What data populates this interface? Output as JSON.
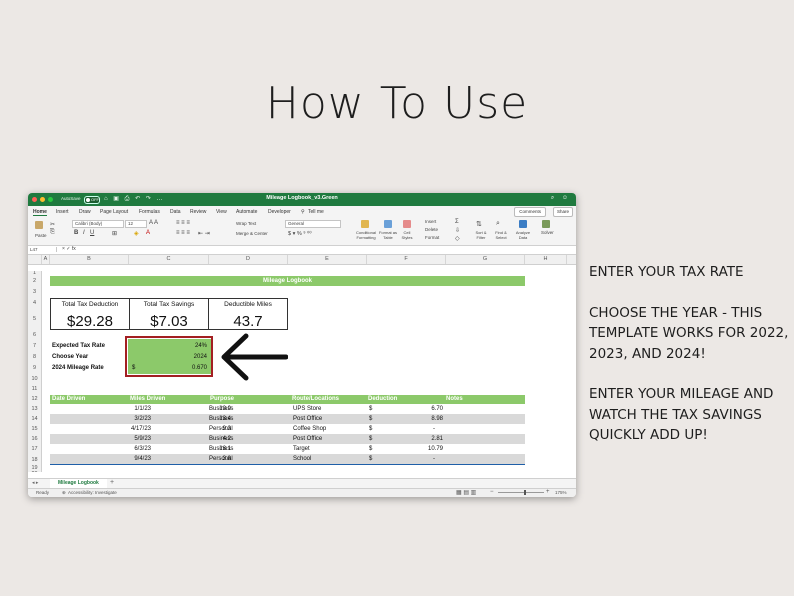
{
  "page_title": "How To Use",
  "instructions": [
    "ENTER YOUR TAX RATE",
    "CHOOSE THE YEAR - THIS TEMPLATE WORKS FOR 2022, 2023, AND 2024!",
    "ENTER YOUR MILEAGE AND WATCH THE TAX SAVINGS QUICKLY ADD UP!"
  ],
  "app": {
    "autosave_label": "AutoSave",
    "autosave_state": "OFF",
    "document_title": "Mileage Logbook_v3.Green",
    "menu": [
      "Home",
      "Insert",
      "Draw",
      "Page Layout",
      "Formulas",
      "Data",
      "Review",
      "View",
      "Automate",
      "Developer"
    ],
    "tell_me": "Tell me",
    "comments_label": "Comments",
    "share_label": "Share"
  },
  "ribbon": {
    "font_name": "Calibri (Body)",
    "font_size": "12",
    "paste_label": "Paste",
    "wrap_text": "Wrap Text",
    "merge_center": "Merge & Center",
    "number_format": "General",
    "conditional_formatting": "Conditional Formatting",
    "format_as_table": "Format as Table",
    "cell_styles": "Cell Styles",
    "insert": "Insert",
    "delete": "Delete",
    "format": "Format",
    "sort_filter": "Sort & Filter",
    "find_select": "Find & Select",
    "analyze_data": "Analyze Data",
    "solver": "Solver"
  },
  "formula_bar": {
    "name_box": "L47"
  },
  "columns": [
    "A",
    "B",
    "C",
    "D",
    "E",
    "F",
    "G",
    "H"
  ],
  "rows": [
    "1",
    "2",
    "3",
    "4",
    "5",
    "6",
    "7",
    "8",
    "9",
    "10",
    "11",
    "12",
    "13",
    "14",
    "15",
    "16",
    "17",
    "18",
    "19",
    "20"
  ],
  "sheet": {
    "banner": "Mileage Logbook",
    "summary": [
      {
        "label": "Total Tax Deduction",
        "value": "$29.28"
      },
      {
        "label": "Total Tax Savings",
        "value": "$7.03"
      },
      {
        "label": "Deductible Miles",
        "value": "43.7"
      }
    ],
    "inputs": [
      {
        "label": "Expected Tax Rate",
        "value": "24%",
        "prefix": ""
      },
      {
        "label": "Choose Year",
        "value": "2024",
        "prefix": ""
      },
      {
        "label": "2024 Mileage Rate",
        "value": "0.670",
        "prefix": "$"
      }
    ],
    "table_headers": [
      "Date Driven",
      "Miles Driven",
      "Purpose",
      "Route/Locations",
      "Deduction",
      "Notes"
    ],
    "table_rows": [
      {
        "date": "1/1/23",
        "miles": "10.0",
        "purpose": "Business",
        "route": "UPS Store",
        "cur": "$",
        "deduction": "6.70"
      },
      {
        "date": "3/2/23",
        "miles": "13.4",
        "purpose": "Business",
        "route": "Post Office",
        "cur": "$",
        "deduction": "8.98"
      },
      {
        "date": "4/17/23",
        "miles": "9.3",
        "purpose": "Personal",
        "route": "Coffee Shop",
        "cur": "$",
        "deduction": "-"
      },
      {
        "date": "5/9/23",
        "miles": "4.2",
        "purpose": "Business",
        "route": "Post Office",
        "cur": "$",
        "deduction": "2.81"
      },
      {
        "date": "6/3/23",
        "miles": "16.1",
        "purpose": "Business",
        "route": "Target",
        "cur": "$",
        "deduction": "10.79"
      },
      {
        "date": "9/4/23",
        "miles": "3.8",
        "purpose": "Personal",
        "route": "School",
        "cur": "$",
        "deduction": "-"
      }
    ]
  },
  "sheet_tab": "Mileage Logbook",
  "status": {
    "ready": "Ready",
    "accessibility": "Accessibility: Investigate",
    "zoom": "175%"
  }
}
